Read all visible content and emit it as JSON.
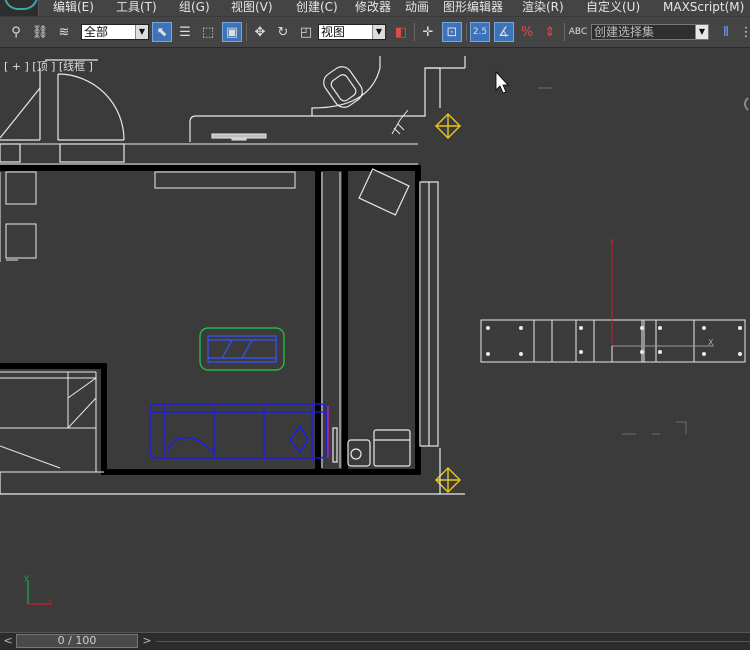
{
  "menu": {
    "items": [
      "编辑(E)",
      "工具(T)",
      "组(G)",
      "视图(V)",
      "创建(C)",
      "修改器",
      "动画",
      "图形编辑器",
      "渲染(R)",
      "自定义(U)",
      "MAXScript(M)"
    ]
  },
  "toolbar": {
    "filter_value": "全部",
    "refcoord_value": "视图",
    "selection_set_placeholder": "创建选择集",
    "snap_label": "2.5",
    "icons": [
      "link-icon",
      "unlink-icon",
      "bind-spacewarp-icon",
      "select-object-icon",
      "select-by-name-icon",
      "rect-region-icon",
      "window-crossing-icon",
      "move-icon",
      "rotate-icon",
      "scale-icon",
      "use-pivot-icon",
      "pivot-icon",
      "select-manipulate-icon",
      "keyboard-shortcut-icon",
      "snaps-toggle-icon",
      "angle-snap-icon",
      "percent-snap-icon",
      "spinner-snap-icon",
      "edit-named-sel-icon",
      "mirror-icon"
    ]
  },
  "viewport": {
    "label": "[ + ] [顶 ] [线框 ]"
  },
  "timeslider": {
    "prev": "<",
    "value": "0 / 100",
    "next": ">"
  },
  "colors": {
    "viewport_bg": "#3b3b3b",
    "wall": "#000000",
    "line": "#e8e8e8",
    "selected_blue": "#1a1aff",
    "selected_green": "#22cc44",
    "gizmo_yellow": "#e8c81e",
    "axis_red": "#c0202a"
  }
}
